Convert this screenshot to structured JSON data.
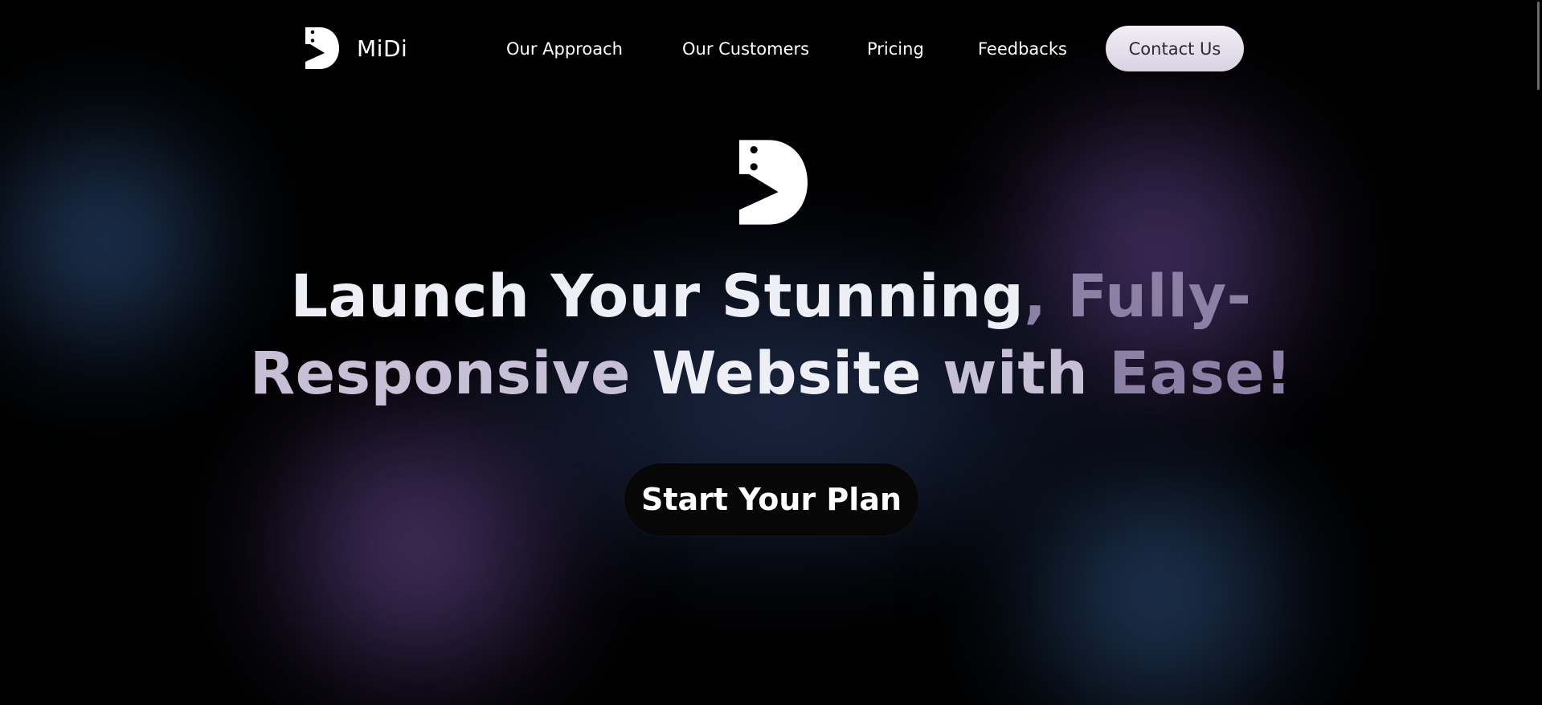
{
  "nav": {
    "brand_name": "MiDi",
    "brand_icon": "midi-logo-icon",
    "links": [
      {
        "label": "Our Approach"
      },
      {
        "label": "Our Customers"
      },
      {
        "label": "Pricing"
      },
      {
        "label": "Feedbacks"
      }
    ],
    "contact_label": "Contact Us"
  },
  "hero": {
    "logo_icon": "midi-logo-icon",
    "headline_parts": [
      {
        "text": "Launch Your Stunning",
        "tone": "white"
      },
      {
        "text": ", Fully-",
        "tone": "muted"
      },
      {
        "text": "Responsive ",
        "tone": "lavender"
      },
      {
        "text": "Website ",
        "tone": "white"
      },
      {
        "text": "with ",
        "tone": "lavender"
      },
      {
        "text": "Ease!",
        "tone": "muted"
      }
    ],
    "cta_label": "Start Your Plan"
  },
  "colors": {
    "background": "#000000",
    "headline_white": "#eeeef6",
    "headline_lavender": "#c6bfd6",
    "headline_muted": "#8c80a6",
    "contact_button": "#e6e1ee",
    "cta_button": "#070707"
  }
}
